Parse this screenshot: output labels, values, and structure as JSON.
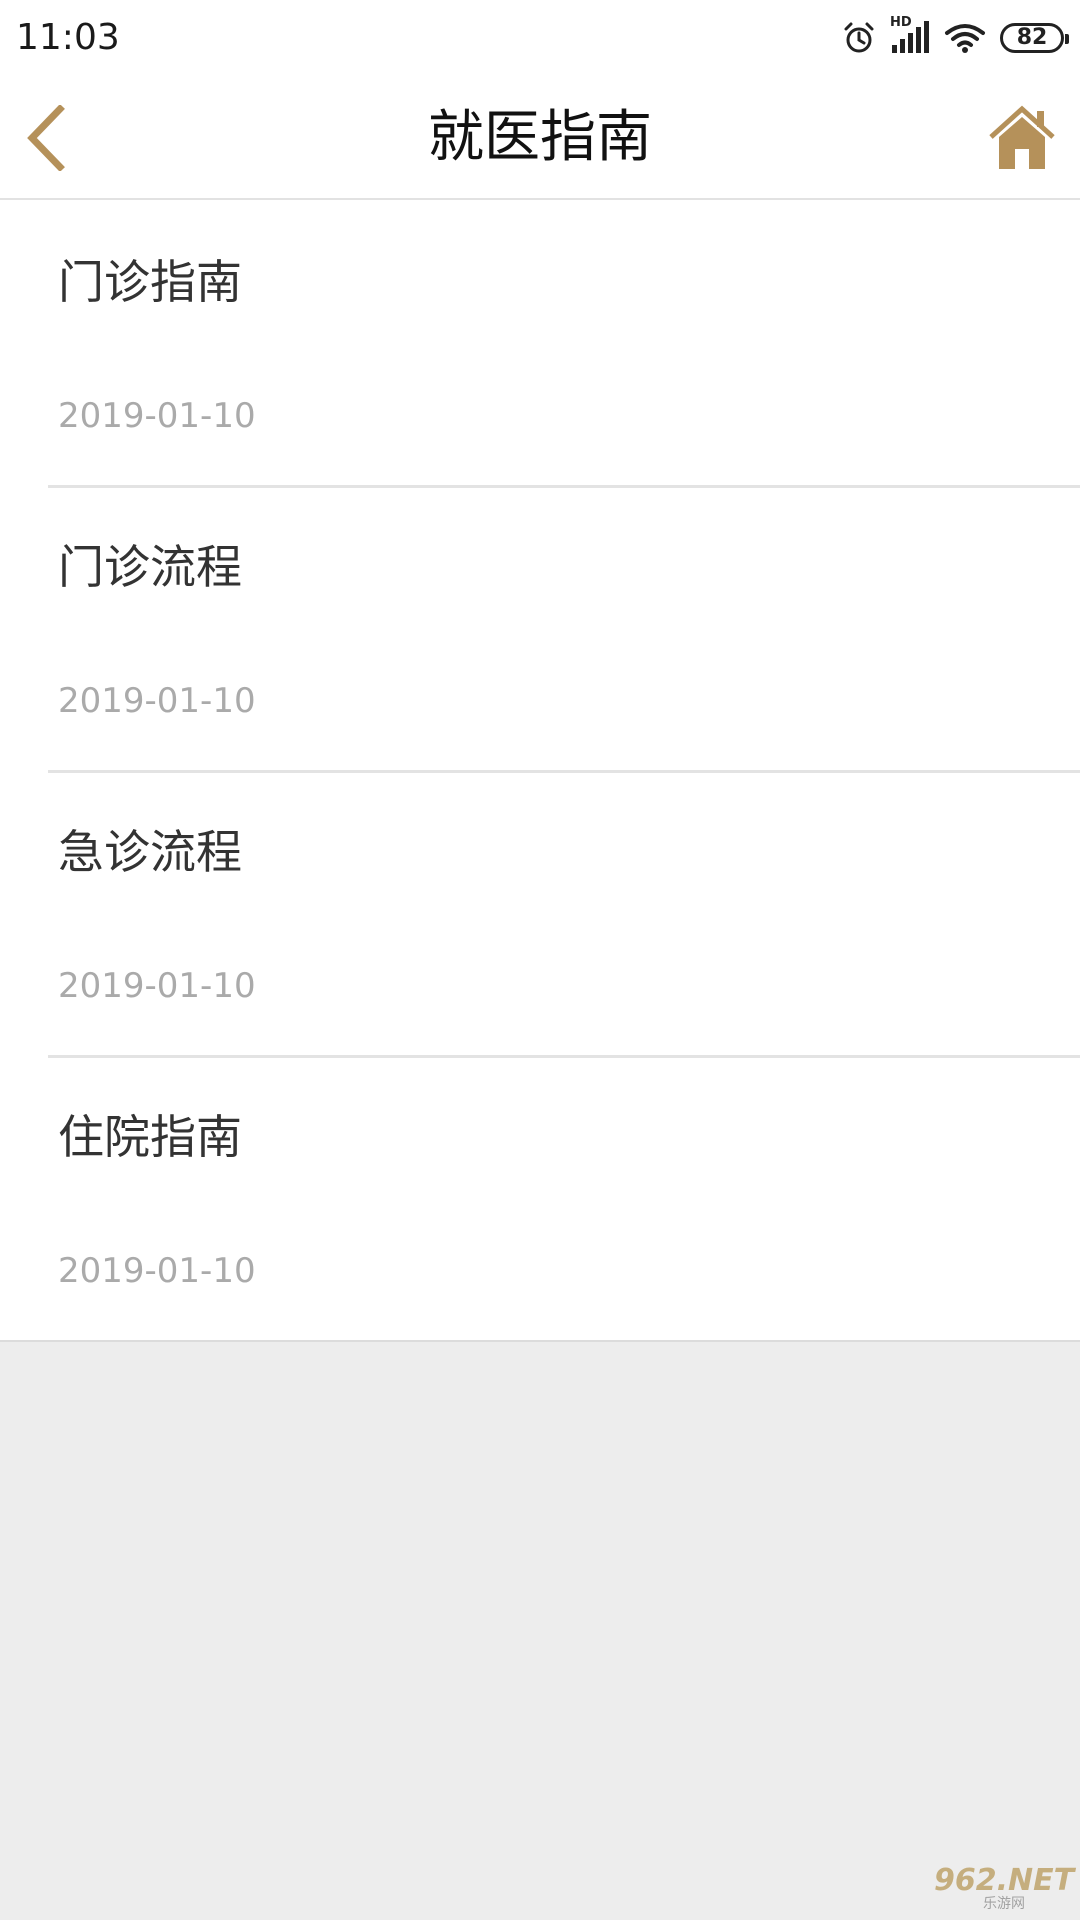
{
  "status_bar": {
    "time": "11:03",
    "network_label": "HD",
    "battery": "82"
  },
  "header": {
    "title": "就医指南",
    "back_icon": "chevron-left-icon",
    "home_icon": "home-icon",
    "accent_color": "#b5915a"
  },
  "list": {
    "items": [
      {
        "title": "门诊指南",
        "date": "2019-01-10"
      },
      {
        "title": "门诊流程",
        "date": "2019-01-10"
      },
      {
        "title": "急诊流程",
        "date": "2019-01-10"
      },
      {
        "title": "住院指南",
        "date": "2019-01-10"
      }
    ]
  },
  "watermark": {
    "top": "962.NET",
    "bottom": "乐游网"
  }
}
